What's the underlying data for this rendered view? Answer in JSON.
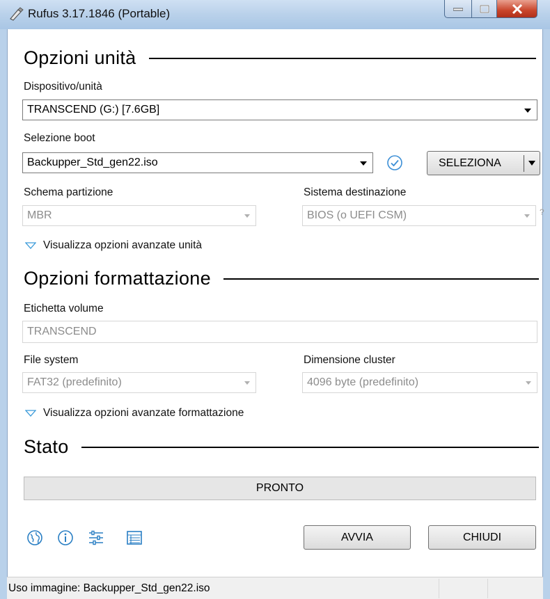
{
  "window": {
    "title": "Rufus 3.17.1846 (Portable)"
  },
  "drive_options": {
    "heading": "Opzioni unità",
    "device_label": "Dispositivo/unità",
    "device_value": "TRANSCEND (G:) [7.6GB]",
    "boot_label": "Selezione boot",
    "boot_value": "Backupper_Std_gen22.iso",
    "select_button": "SELEZIONA",
    "partition_label": "Schema partizione",
    "partition_value": "MBR",
    "target_label": "Sistema destinazione",
    "target_value": "BIOS (o UEFI CSM)",
    "help_mark": "?",
    "advanced_toggle": "Visualizza opzioni avanzate unità"
  },
  "format_options": {
    "heading": "Opzioni formattazione",
    "volume_label": "Etichetta volume",
    "volume_value": "TRANSCEND",
    "fs_label": "File system",
    "fs_value": "FAT32 (predefinito)",
    "cluster_label": "Dimensione cluster",
    "cluster_value": "4096 byte (predefinito)",
    "advanced_toggle": "Visualizza opzioni avanzate formattazione"
  },
  "status": {
    "heading": "Stato",
    "progress_text": "PRONTO",
    "progress_fraction": 0
  },
  "buttons": {
    "start": "AVVIA",
    "close": "CHIUDI"
  },
  "toolbar_icons": [
    "language-icon",
    "info-icon",
    "settings-icon",
    "log-icon"
  ],
  "footer": {
    "text": "Uso immagine: Backupper_Std_gen22.iso"
  },
  "colors": {
    "titlebar": "#b9d1ea",
    "close_button": "#c9452b",
    "icon_blue": "#2a7fc4",
    "check_blue": "#3c8fd6"
  }
}
